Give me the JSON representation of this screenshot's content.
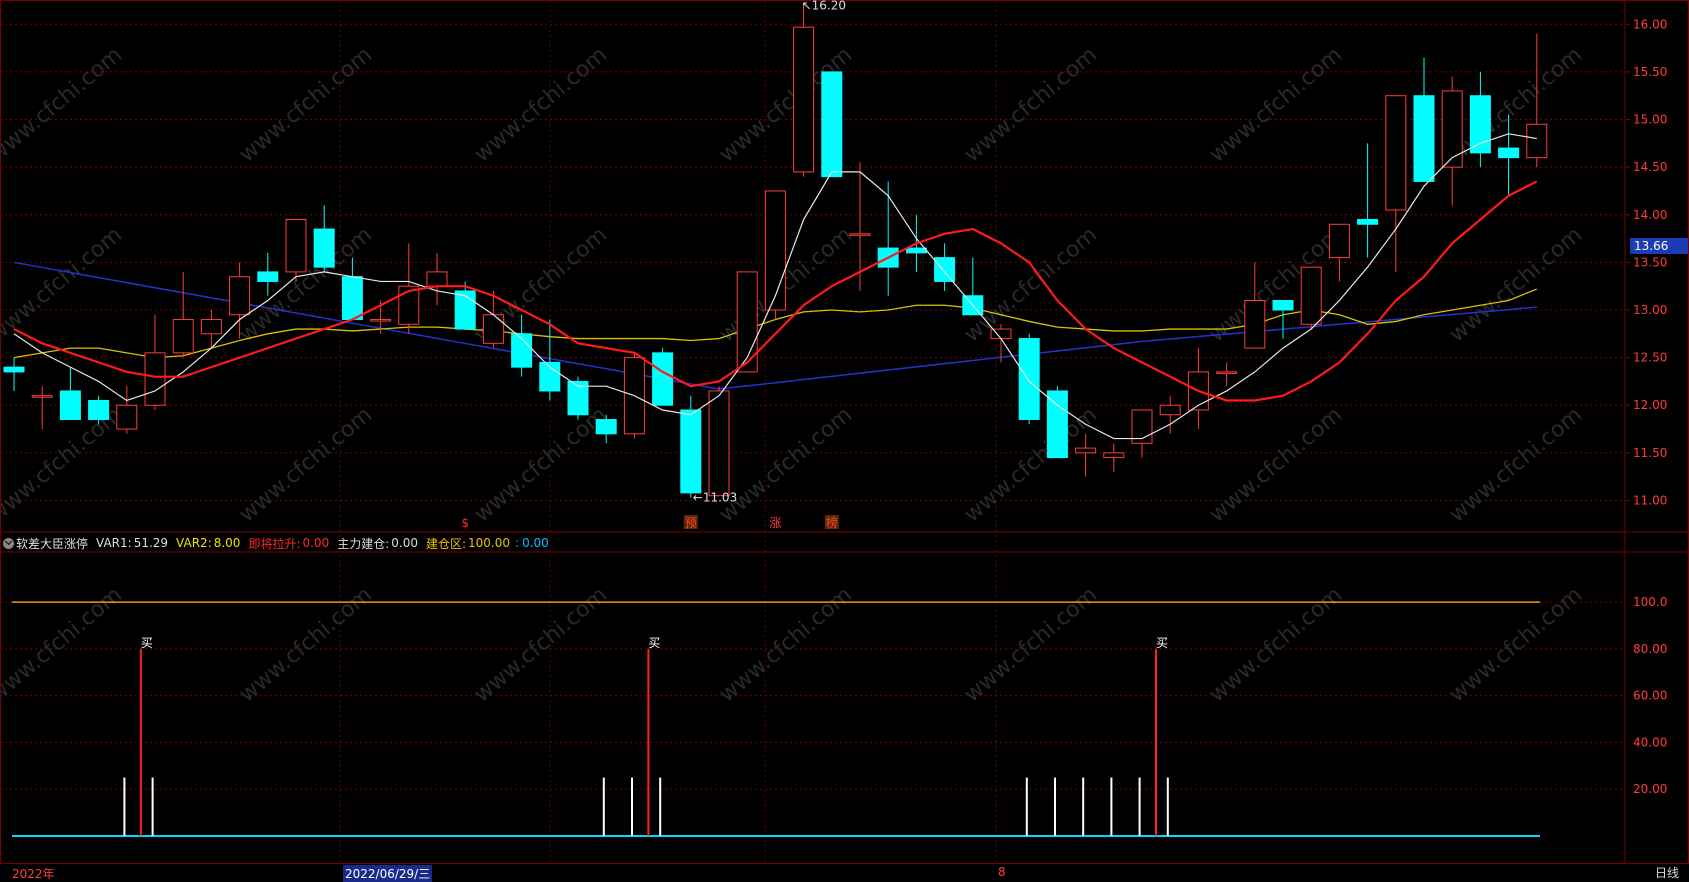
{
  "chart_data": [
    {
      "type": "candlestick",
      "y_ticks": [
        "16.00",
        "15.50",
        "15.00",
        "14.50",
        "14.00",
        "13.50",
        "13.00",
        "12.50",
        "12.00",
        "11.50",
        "11.00"
      ],
      "ylim": [
        10.9,
        16.15
      ],
      "candles": [
        {
          "o": 12.4,
          "h": 12.5,
          "l": 12.15,
          "c": 12.35
        },
        {
          "o": 12.1,
          "h": 12.2,
          "l": 11.75,
          "c": 12.1
        },
        {
          "o": 12.15,
          "h": 12.4,
          "l": 11.85,
          "c": 11.85
        },
        {
          "o": 12.05,
          "h": 12.1,
          "l": 11.8,
          "c": 11.85
        },
        {
          "o": 11.75,
          "h": 12.2,
          "l": 11.7,
          "c": 12.0
        },
        {
          "o": 12.0,
          "h": 12.95,
          "l": 11.95,
          "c": 12.55
        },
        {
          "o": 12.55,
          "h": 13.4,
          "l": 12.5,
          "c": 12.9
        },
        {
          "o": 12.75,
          "h": 13.0,
          "l": 12.6,
          "c": 12.9
        },
        {
          "o": 12.95,
          "h": 13.5,
          "l": 12.7,
          "c": 13.35
        },
        {
          "o": 13.4,
          "h": 13.6,
          "l": 13.15,
          "c": 13.3
        },
        {
          "o": 13.4,
          "h": 13.85,
          "l": 13.3,
          "c": 13.95
        },
        {
          "o": 13.85,
          "h": 14.1,
          "l": 13.4,
          "c": 13.45
        },
        {
          "o": 13.35,
          "h": 13.55,
          "l": 12.9,
          "c": 12.9
        },
        {
          "o": 12.9,
          "h": 13.1,
          "l": 12.75,
          "c": 12.9
        },
        {
          "o": 12.85,
          "h": 13.7,
          "l": 12.75,
          "c": 13.25
        },
        {
          "o": 13.25,
          "h": 13.6,
          "l": 13.05,
          "c": 13.4
        },
        {
          "o": 13.2,
          "h": 13.3,
          "l": 12.8,
          "c": 12.8
        },
        {
          "o": 12.65,
          "h": 13.2,
          "l": 12.6,
          "c": 12.95
        },
        {
          "o": 12.75,
          "h": 12.95,
          "l": 12.3,
          "c": 12.4
        },
        {
          "o": 12.45,
          "h": 12.9,
          "l": 12.05,
          "c": 12.15
        },
        {
          "o": 12.25,
          "h": 12.3,
          "l": 11.85,
          "c": 11.9
        },
        {
          "o": 11.85,
          "h": 11.9,
          "l": 11.6,
          "c": 11.7
        },
        {
          "o": 11.7,
          "h": 12.55,
          "l": 11.65,
          "c": 12.5
        },
        {
          "o": 12.55,
          "h": 12.6,
          "l": 12.05,
          "c": 12.0
        },
        {
          "o": 11.95,
          "h": 12.1,
          "l": 11.03,
          "c": 11.08
        },
        {
          "o": 11.05,
          "h": 12.2,
          "l": 11.05,
          "c": 12.15
        },
        {
          "o": 12.35,
          "h": 13.4,
          "l": 12.35,
          "c": 13.4
        },
        {
          "o": 13.0,
          "h": 14.0,
          "l": 12.9,
          "c": 14.25
        },
        {
          "o": 14.45,
          "h": 16.2,
          "l": 14.4,
          "c": 15.97
        },
        {
          "o": 15.5,
          "h": 15.5,
          "l": 14.4,
          "c": 14.4
        },
        {
          "o": 13.8,
          "h": 14.55,
          "l": 13.2,
          "c": 13.8
        },
        {
          "o": 13.65,
          "h": 14.35,
          "l": 13.15,
          "c": 13.45
        },
        {
          "o": 13.65,
          "h": 14.0,
          "l": 13.4,
          "c": 13.6
        },
        {
          "o": 13.55,
          "h": 13.7,
          "l": 13.2,
          "c": 13.3
        },
        {
          "o": 13.15,
          "h": 13.55,
          "l": 12.95,
          "c": 12.95
        },
        {
          "o": 12.7,
          "h": 12.85,
          "l": 12.45,
          "c": 12.8
        },
        {
          "o": 12.7,
          "h": 12.75,
          "l": 11.8,
          "c": 11.85
        },
        {
          "o": 12.15,
          "h": 12.2,
          "l": 11.45,
          "c": 11.45
        },
        {
          "o": 11.5,
          "h": 11.7,
          "l": 11.25,
          "c": 11.55
        },
        {
          "o": 11.45,
          "h": 11.6,
          "l": 11.3,
          "c": 11.5
        },
        {
          "o": 11.6,
          "h": 11.95,
          "l": 11.45,
          "c": 11.95
        },
        {
          "o": 11.9,
          "h": 12.1,
          "l": 11.7,
          "c": 12.0
        },
        {
          "o": 11.95,
          "h": 12.6,
          "l": 11.75,
          "c": 12.35
        },
        {
          "o": 12.35,
          "h": 12.45,
          "l": 12.2,
          "c": 12.35
        },
        {
          "o": 12.6,
          "h": 13.5,
          "l": 12.6,
          "c": 13.1
        },
        {
          "o": 13.1,
          "h": 13.1,
          "l": 12.7,
          "c": 13.0
        },
        {
          "o": 12.85,
          "h": 13.45,
          "l": 12.8,
          "c": 13.45
        },
        {
          "o": 13.55,
          "h": 13.75,
          "l": 13.3,
          "c": 13.9
        },
        {
          "o": 13.95,
          "h": 14.75,
          "l": 13.55,
          "c": 13.9
        },
        {
          "o": 14.05,
          "h": 14.15,
          "l": 13.4,
          "c": 15.25
        },
        {
          "o": 15.25,
          "h": 15.65,
          "l": 14.35,
          "c": 14.35
        },
        {
          "o": 14.5,
          "h": 15.45,
          "l": 14.1,
          "c": 15.3
        },
        {
          "o": 15.25,
          "h": 15.5,
          "l": 14.5,
          "c": 14.65
        },
        {
          "o": 14.7,
          "h": 15.05,
          "l": 14.2,
          "c": 14.6
        },
        {
          "o": 14.6,
          "h": 15.9,
          "l": 14.5,
          "c": 14.95
        }
      ],
      "ma_white": [
        12.75,
        12.55,
        12.4,
        12.25,
        12.05,
        12.15,
        12.35,
        12.6,
        12.9,
        13.1,
        13.35,
        13.4,
        13.35,
        13.3,
        13.3,
        13.2,
        13.15,
        12.95,
        12.7,
        12.4,
        12.2,
        12.2,
        12.1,
        11.95,
        11.9,
        12.1,
        12.5,
        13.15,
        13.95,
        14.45,
        14.45,
        14.2,
        13.75,
        13.4,
        13.05,
        12.7,
        12.25,
        12.0,
        11.8,
        11.65,
        11.65,
        11.8,
        12.0,
        12.15,
        12.35,
        12.6,
        12.8,
        13.1,
        13.45,
        13.85,
        14.3,
        14.6,
        14.75,
        14.85,
        14.8
      ],
      "ma_red": [
        12.8,
        12.65,
        12.55,
        12.45,
        12.35,
        12.3,
        12.3,
        12.4,
        12.5,
        12.6,
        12.7,
        12.8,
        12.9,
        13.05,
        13.2,
        13.25,
        13.25,
        13.15,
        13.0,
        12.85,
        12.65,
        12.6,
        12.55,
        12.35,
        12.2,
        12.25,
        12.45,
        12.75,
        13.05,
        13.25,
        13.4,
        13.55,
        13.7,
        13.8,
        13.85,
        13.7,
        13.5,
        13.1,
        12.8,
        12.6,
        12.45,
        12.3,
        12.15,
        12.05,
        12.05,
        12.1,
        12.25,
        12.45,
        12.75,
        13.1,
        13.35,
        13.7,
        13.95,
        14.2,
        14.35
      ],
      "ma_yellow": [
        12.5,
        12.55,
        12.6,
        12.6,
        12.55,
        12.5,
        12.52,
        12.6,
        12.68,
        12.75,
        12.8,
        12.8,
        12.78,
        12.8,
        12.82,
        12.82,
        12.8,
        12.78,
        12.75,
        12.72,
        12.7,
        12.7,
        12.7,
        12.7,
        12.68,
        12.7,
        12.8,
        12.9,
        12.98,
        13.0,
        12.98,
        13.0,
        13.05,
        13.05,
        13.02,
        12.95,
        12.88,
        12.82,
        12.8,
        12.78,
        12.78,
        12.8,
        12.8,
        12.8,
        12.85,
        12.95,
        13.0,
        12.95,
        12.85,
        12.88,
        12.95,
        13.0,
        13.05,
        13.1,
        13.22
      ],
      "ma_blue_start": 13.5,
      "ma_blue_min_index": 25,
      "ma_blue_min": 12.17,
      "ma_blue_mid_index": 40,
      "ma_blue_mid": 12.67,
      "ma_blue_end": 13.03,
      "annotations": [
        {
          "text": "16.20",
          "index": 28,
          "value": 16.2,
          "arrow": "↖"
        },
        {
          "text": "11.03",
          "index": 24,
          "value": 11.03,
          "arrow": "←"
        }
      ],
      "markers": [
        {
          "index": 16,
          "text": "$",
          "color": "#ff2a2a",
          "boxed": false
        },
        {
          "index": 24,
          "text": "预",
          "color": "#ff3b3b",
          "boxed": true
        },
        {
          "index": 27,
          "text": "涨",
          "color": "#ff3b3b",
          "boxed": false
        },
        {
          "index": 29,
          "text": "榜",
          "color": "#ff3b3b",
          "boxed": true
        }
      ],
      "last_price": "13.66"
    },
    {
      "type": "indicator",
      "y_ticks": [
        "100.0",
        "80.00",
        "60.00",
        "40.00",
        "20.00"
      ],
      "ylim": [
        0,
        118
      ],
      "line_100": 100,
      "buy_label": "买",
      "buy_indices": [
        4,
        22,
        40
      ],
      "white_bar_indices": [
        2,
        3,
        19,
        20,
        21,
        34,
        35,
        36,
        37,
        38,
        39
      ],
      "white_bar_value": 25,
      "baseline": 0
    }
  ],
  "legend": {
    "name": "软差大臣涨停",
    "var1_label": "VAR1:",
    "var1_value": "51.29",
    "var2_label": "VAR2:",
    "var2_value": "8.00",
    "pull_label": "即将拉升:",
    "pull_value": "0.00",
    "main_label": "主力建仓:",
    "main_value": "0.00",
    "zone_label": "建仓区:",
    "zone_value1": "100.00",
    "zone_sep": ":",
    "zone_value2": "0.00"
  },
  "bottom": {
    "year_label": "2022年",
    "selected_date": "2022/06/29/三",
    "month_label": "8",
    "period_label": "日线"
  },
  "watermark": "www.cfchi.com",
  "colors": {
    "up": "#ff3b3b",
    "down": "#00ffff",
    "ma_white": "#e8e8e8",
    "ma_red": "#ff1a1a",
    "ma_yellow": "#d6c400",
    "ma_blue": "#2233cc",
    "grid": "#7a0000"
  }
}
